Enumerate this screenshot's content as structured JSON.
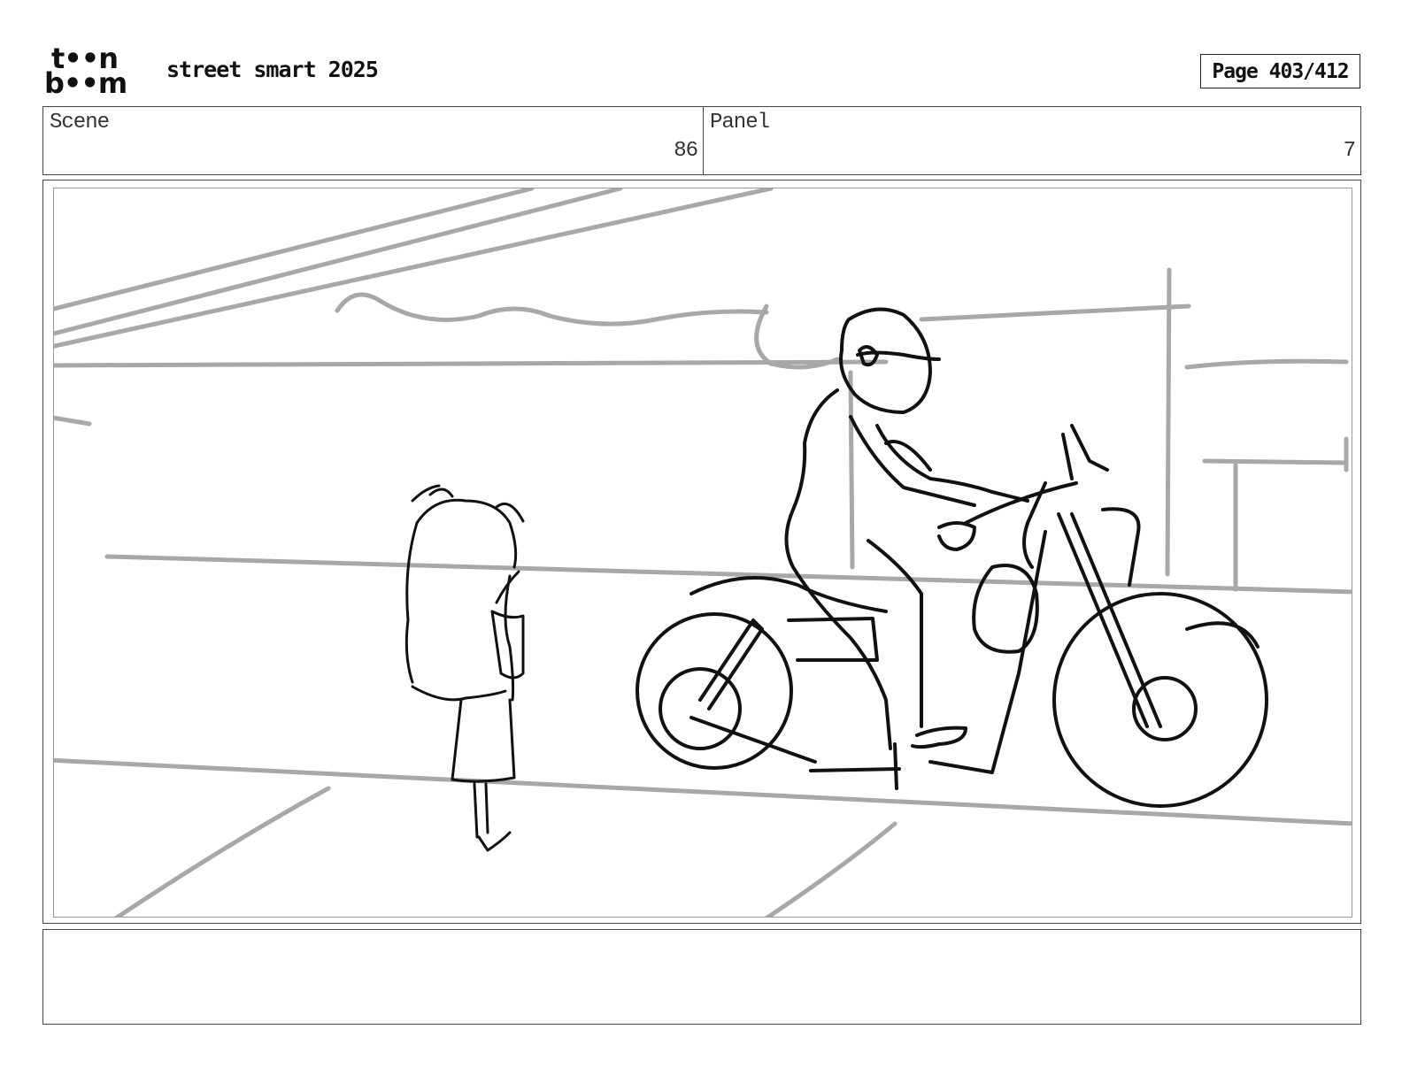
{
  "logo": {
    "line1": "t••n",
    "line2": "b••m"
  },
  "header": {
    "project_title": "street smart 2025",
    "page_indicator": "Page 403/412"
  },
  "scene": {
    "label": "Scene",
    "value": "86"
  },
  "panel": {
    "label": "Panel",
    "value": "7"
  },
  "caption": {
    "text": ""
  }
}
